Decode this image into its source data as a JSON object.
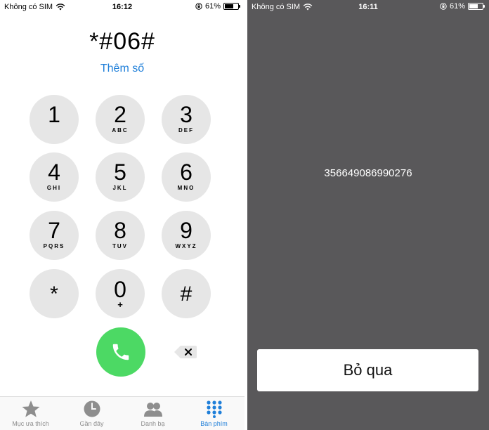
{
  "left_screen": {
    "status_bar": {
      "carrier": "Không có SIM",
      "time": "16:12",
      "battery": "61%"
    },
    "dialed_number": "*#06#",
    "add_number_label": "Thêm số",
    "keypad": [
      {
        "digit": "1",
        "letters": ""
      },
      {
        "digit": "2",
        "letters": "ABC"
      },
      {
        "digit": "3",
        "letters": "DEF"
      },
      {
        "digit": "4",
        "letters": "GHI"
      },
      {
        "digit": "5",
        "letters": "JKL"
      },
      {
        "digit": "6",
        "letters": "MNO"
      },
      {
        "digit": "7",
        "letters": "PQRS"
      },
      {
        "digit": "8",
        "letters": "TUV"
      },
      {
        "digit": "9",
        "letters": "WXYZ"
      },
      {
        "digit": "*",
        "letters": ""
      },
      {
        "digit": "0",
        "letters": "+"
      },
      {
        "digit": "#",
        "letters": ""
      }
    ],
    "tabs": [
      {
        "label": "Mục ưa thích",
        "icon": "star-icon"
      },
      {
        "label": "Gần đây",
        "icon": "clock-icon"
      },
      {
        "label": "Danh bạ",
        "icon": "contacts-icon"
      },
      {
        "label": "Bàn phím",
        "icon": "keypad-icon",
        "active": true
      }
    ],
    "colors": {
      "call": "#4cd964",
      "accent": "#1f7fd9",
      "key_bg": "#e6e6e6"
    }
  },
  "right_screen": {
    "status_bar": {
      "carrier": "Không có SIM",
      "time": "16:11",
      "battery": "61%"
    },
    "imei": "356649086990276",
    "dismiss_label": "Bỏ qua",
    "colors": {
      "background": "#59585a"
    }
  }
}
